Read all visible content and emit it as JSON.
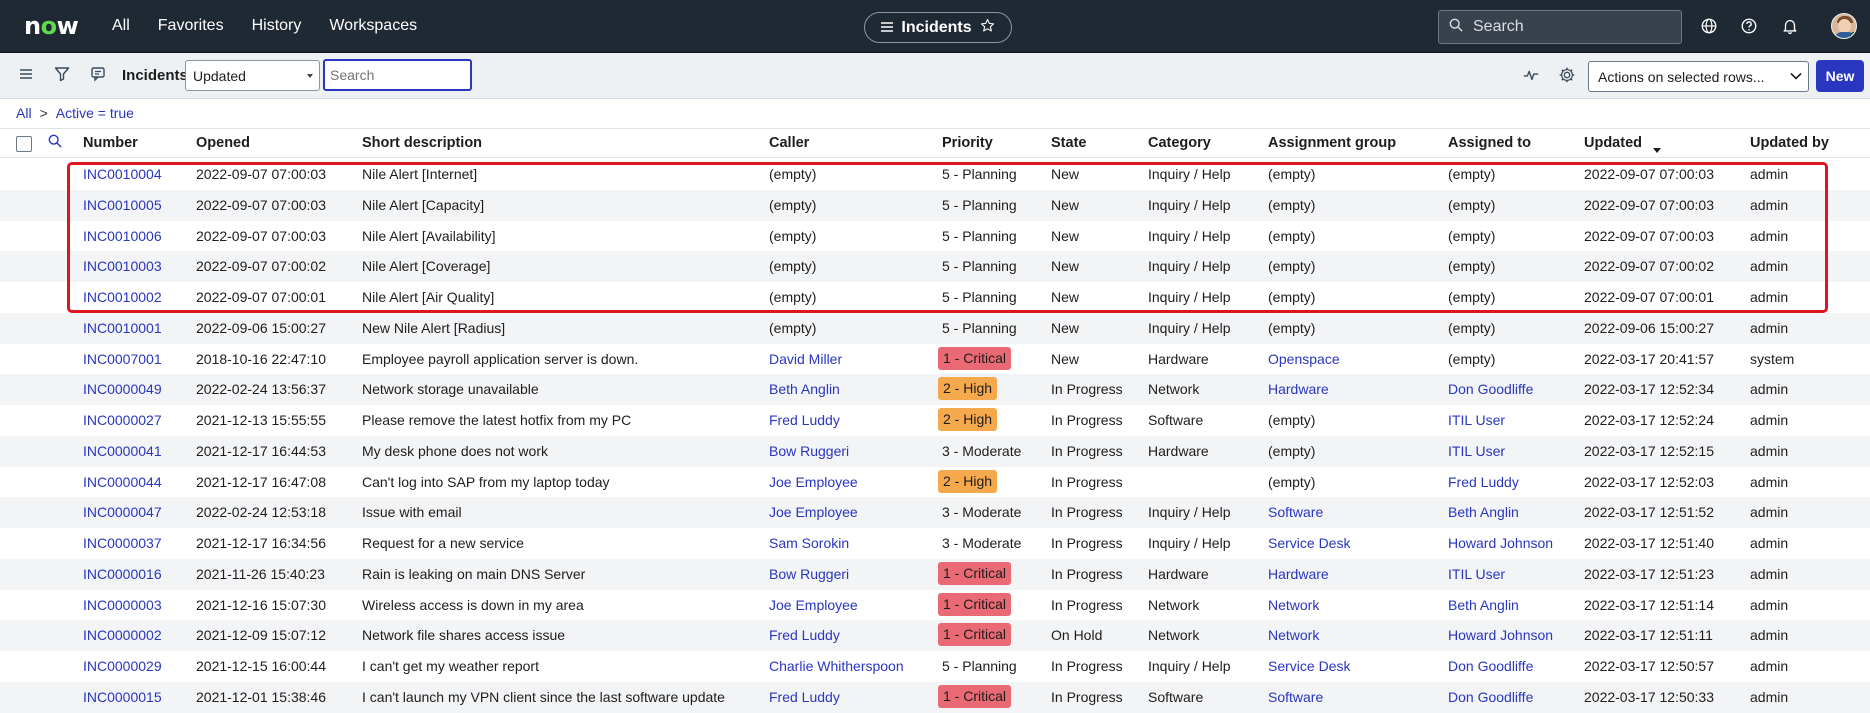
{
  "topbar": {
    "logo": "now",
    "nav": [
      "All",
      "Favorites",
      "History",
      "Workspaces"
    ],
    "title": "Incidents",
    "search_placeholder": "Search",
    "icons": [
      "globe-icon",
      "help-icon",
      "bell-icon"
    ]
  },
  "toolbar": {
    "title": "Incidents",
    "field_select": "Updated",
    "search_placeholder": "Search",
    "actions_label": "Actions on selected rows...",
    "new_label": "New"
  },
  "breadcrumb": {
    "all": "All",
    "separator": ">",
    "filter": "Active = true"
  },
  "columns": [
    "Number",
    "Opened",
    "Short description",
    "Caller",
    "Priority",
    "State",
    "Category",
    "Assignment group",
    "Assigned to",
    "Updated",
    "Updated by"
  ],
  "sort_column": "Updated",
  "rows": [
    {
      "number": "INC0010004",
      "opened": "2022-09-07 07:00:03",
      "desc": "Nile Alert [Internet]",
      "caller": "(empty)",
      "priority": "5 - Planning",
      "state": "New",
      "category": "Inquiry / Help",
      "group": "(empty)",
      "assigned": "(empty)",
      "updated": "2022-09-07 07:00:03",
      "updated_by": "admin"
    },
    {
      "number": "INC0010005",
      "opened": "2022-09-07 07:00:03",
      "desc": "Nile Alert [Capacity]",
      "caller": "(empty)",
      "priority": "5 - Planning",
      "state": "New",
      "category": "Inquiry / Help",
      "group": "(empty)",
      "assigned": "(empty)",
      "updated": "2022-09-07 07:00:03",
      "updated_by": "admin"
    },
    {
      "number": "INC0010006",
      "opened": "2022-09-07 07:00:03",
      "desc": "Nile Alert [Availability]",
      "caller": "(empty)",
      "priority": "5 - Planning",
      "state": "New",
      "category": "Inquiry / Help",
      "group": "(empty)",
      "assigned": "(empty)",
      "updated": "2022-09-07 07:00:03",
      "updated_by": "admin"
    },
    {
      "number": "INC0010003",
      "opened": "2022-09-07 07:00:02",
      "desc": "Nile Alert [Coverage]",
      "caller": "(empty)",
      "priority": "5 - Planning",
      "state": "New",
      "category": "Inquiry / Help",
      "group": "(empty)",
      "assigned": "(empty)",
      "updated": "2022-09-07 07:00:02",
      "updated_by": "admin"
    },
    {
      "number": "INC0010002",
      "opened": "2022-09-07 07:00:01",
      "desc": "Nile Alert [Air Quality]",
      "caller": "(empty)",
      "priority": "5 - Planning",
      "state": "New",
      "category": "Inquiry / Help",
      "group": "(empty)",
      "assigned": "(empty)",
      "updated": "2022-09-07 07:00:01",
      "updated_by": "admin"
    },
    {
      "number": "INC0010001",
      "opened": "2022-09-06 15:00:27",
      "desc": "New Nile Alert [Radius]",
      "caller": "(empty)",
      "priority": "5 - Planning",
      "state": "New",
      "category": "Inquiry / Help",
      "group": "(empty)",
      "assigned": "(empty)",
      "updated": "2022-09-06 15:00:27",
      "updated_by": "admin"
    },
    {
      "number": "INC0007001",
      "opened": "2018-10-16 22:47:10",
      "desc": "Employee payroll application server is down.",
      "caller": "David Miller",
      "priority": "1 - Critical",
      "state": "New",
      "category": "Hardware",
      "group": "Openspace",
      "assigned": "(empty)",
      "updated": "2022-03-17 20:41:57",
      "updated_by": "system"
    },
    {
      "number": "INC0000049",
      "opened": "2022-02-24 13:56:37",
      "desc": "Network storage unavailable",
      "caller": "Beth Anglin",
      "priority": "2 - High",
      "state": "In Progress",
      "category": "Network",
      "group": "Hardware",
      "assigned": "Don Goodliffe",
      "updated": "2022-03-17 12:52:34",
      "updated_by": "admin"
    },
    {
      "number": "INC0000027",
      "opened": "2021-12-13 15:55:55",
      "desc": "Please remove the latest hotfix from my PC",
      "caller": "Fred Luddy",
      "priority": "2 - High",
      "state": "In Progress",
      "category": "Software",
      "group": "(empty)",
      "assigned": "ITIL User",
      "updated": "2022-03-17 12:52:24",
      "updated_by": "admin"
    },
    {
      "number": "INC0000041",
      "opened": "2021-12-17 16:44:53",
      "desc": "My desk phone does not work",
      "caller": "Bow Ruggeri",
      "priority": "3 - Moderate",
      "state": "In Progress",
      "category": "Hardware",
      "group": "(empty)",
      "assigned": "ITIL User",
      "updated": "2022-03-17 12:52:15",
      "updated_by": "admin"
    },
    {
      "number": "INC0000044",
      "opened": "2021-12-17 16:47:08",
      "desc": "Can't log into SAP from my laptop today",
      "caller": "Joe Employee",
      "priority": "2 - High",
      "state": "In Progress",
      "category": "",
      "group": "(empty)",
      "assigned": "Fred Luddy",
      "updated": "2022-03-17 12:52:03",
      "updated_by": "admin"
    },
    {
      "number": "INC0000047",
      "opened": "2022-02-24 12:53:18",
      "desc": "Issue with email",
      "caller": "Joe Employee",
      "priority": "3 - Moderate",
      "state": "In Progress",
      "category": "Inquiry / Help",
      "group": "Software",
      "assigned": "Beth Anglin",
      "updated": "2022-03-17 12:51:52",
      "updated_by": "admin"
    },
    {
      "number": "INC0000037",
      "opened": "2021-12-17 16:34:56",
      "desc": "Request for a new service",
      "caller": "Sam Sorokin",
      "priority": "3 - Moderate",
      "state": "In Progress",
      "category": "Inquiry / Help",
      "group": "Service Desk",
      "assigned": "Howard Johnson",
      "updated": "2022-03-17 12:51:40",
      "updated_by": "admin"
    },
    {
      "number": "INC0000016",
      "opened": "2021-11-26 15:40:23",
      "desc": "Rain is leaking on main DNS Server",
      "caller": "Bow Ruggeri",
      "priority": "1 - Critical",
      "state": "In Progress",
      "category": "Hardware",
      "group": "Hardware",
      "assigned": "ITIL User",
      "updated": "2022-03-17 12:51:23",
      "updated_by": "admin"
    },
    {
      "number": "INC0000003",
      "opened": "2021-12-16 15:07:30",
      "desc": "Wireless access is down in my area",
      "caller": "Joe Employee",
      "priority": "1 - Critical",
      "state": "In Progress",
      "category": "Network",
      "group": "Network",
      "assigned": "Beth Anglin",
      "updated": "2022-03-17 12:51:14",
      "updated_by": "admin"
    },
    {
      "number": "INC0000002",
      "opened": "2021-12-09 15:07:12",
      "desc": "Network file shares access issue",
      "caller": "Fred Luddy",
      "priority": "1 - Critical",
      "state": "On Hold",
      "category": "Network",
      "group": "Network",
      "assigned": "Howard Johnson",
      "updated": "2022-03-17 12:51:11",
      "updated_by": "admin"
    },
    {
      "number": "INC0000029",
      "opened": "2021-12-15 16:00:44",
      "desc": "I can't get my weather report",
      "caller": "Charlie Whitherspoon",
      "priority": "5 - Planning",
      "state": "In Progress",
      "category": "Inquiry / Help",
      "group": "Service Desk",
      "assigned": "Don Goodliffe",
      "updated": "2022-03-17 12:50:57",
      "updated_by": "admin"
    },
    {
      "number": "INC0000015",
      "opened": "2021-12-01 15:38:46",
      "desc": "I can't launch my VPN client since the last software update",
      "caller": "Fred Luddy",
      "priority": "1 - Critical",
      "state": "In Progress",
      "category": "Software",
      "group": "Software",
      "assigned": "Don Goodliffe",
      "updated": "2022-03-17 12:50:33",
      "updated_by": "admin"
    }
  ],
  "colors": {
    "topbar": "#1f2933",
    "link": "#2936c0",
    "critical": "#e96a74",
    "high": "#f6a84d",
    "highlight_box": "#e0141e",
    "logo_accent": "#62d84e"
  }
}
